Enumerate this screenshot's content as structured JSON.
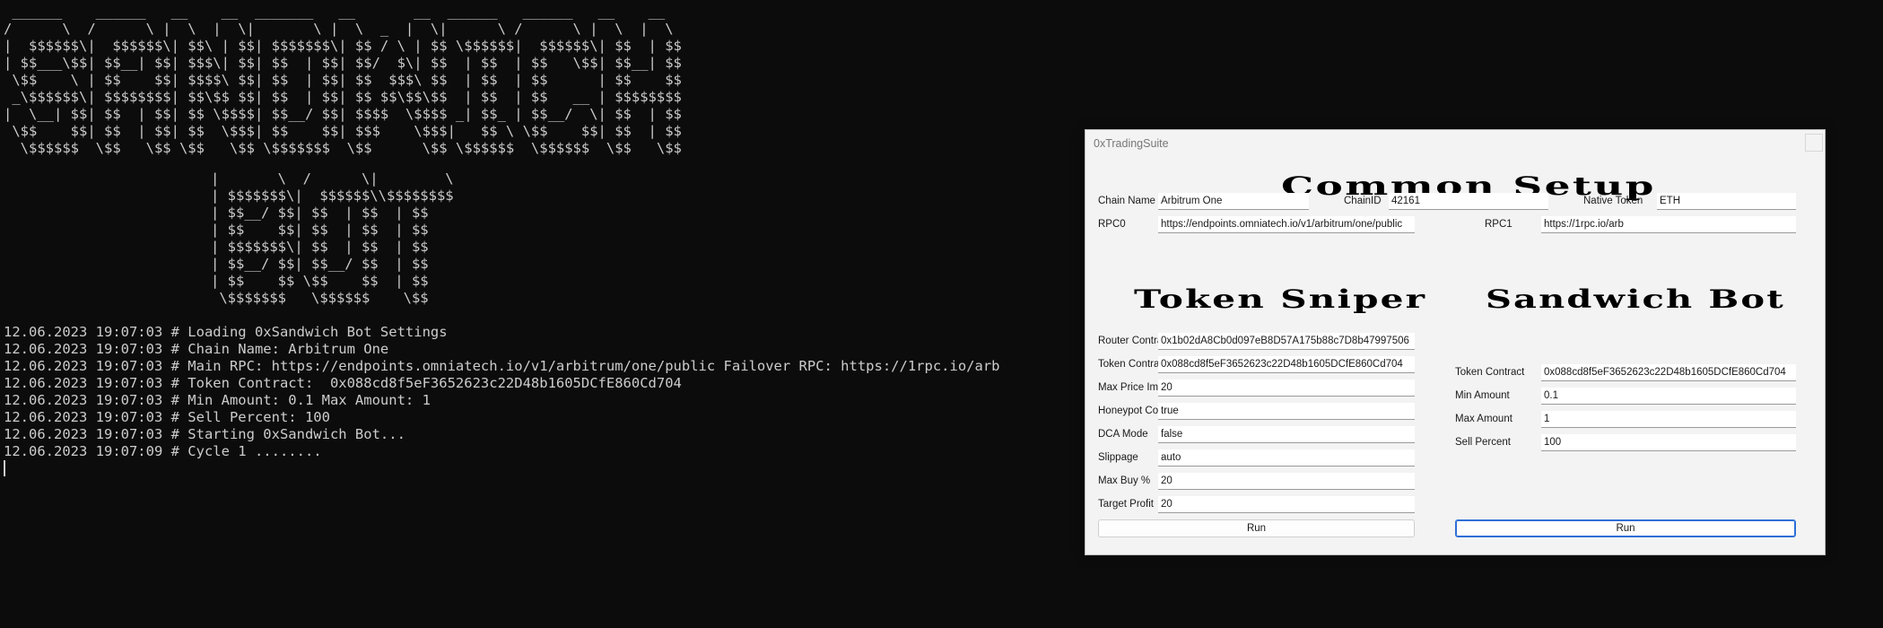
{
  "console": {
    "ascii_top": " ______    ______   __    __  _______   __       __  ______   ______   __    __ \n/      \\  /      \\ |  \\  |  \\|       \\ |  \\  _  |  \\|      \\ /      \\ |  \\  |  \\\n|  $$$$$$\\|  $$$$$$\\| $$\\ | $$| $$$$$$$\\| $$ / \\ | $$ \\$$$$$$|  $$$$$$\\| $$  | $$\n| $$___\\$$| $$__| $$| $$$\\| $$| $$  | $$| $$/  $\\| $$  | $$  | $$   \\$$| $$__| $$\n \\$$    \\ | $$    $$| $$$$\\ $$| $$  | $$| $$  $$$\\ $$  | $$  | $$      | $$    $$\n _\\$$$$$$\\| $$$$$$$$| $$\\$$ $$| $$  | $$| $$ $$\\$$\\$$  | $$  | $$   __ | $$$$$$$$\n|  \\__| $$| $$  | $$| $$ \\$$$$| $$__/ $$| $$$$  \\$$$$ _| $$_ | $$__/  \\| $$  | $$\n \\$$    $$| $$  | $$| $$  \\$$$| $$    $$| $$$    \\$$$|   $$ \\ \\$$    $$| $$  | $$\n  \\$$$$$$  \\$$   \\$$ \\$$   \\$$ \\$$$$$$$  \\$$      \\$$ \\$$$$$$  \\$$$$$$  \\$$   \\$$",
    "ascii_bottom": "|       \\  /      \\|        \\\n| $$$$$$$\\|  $$$$$$\\\\$$$$$$$$\n| $$__/ $$| $$  | $$  | $$\n| $$    $$| $$  | $$  | $$\n| $$$$$$$\\| $$  | $$  | $$\n| $$__/ $$| $$__/ $$  | $$\n| $$    $$ \\$$    $$  | $$\n \\$$$$$$$   \\$$$$$$    \\$$",
    "log_lines": [
      "12.06.2023 19:07:03 # Loading 0xSandwich Bot Settings",
      "12.06.2023 19:07:03 # Chain Name: Arbitrum One",
      "12.06.2023 19:07:03 # Main RPC: https://endpoints.omniatech.io/v1/arbitrum/one/public Failover RPC: https://1rpc.io/arb",
      "12.06.2023 19:07:03 # Token Contract:  0x088cd8f5eF3652623c22D48b1605DCfE860Cd704",
      "12.06.2023 19:07:03 # Min Amount: 0.1 Max Amount: 1",
      "12.06.2023 19:07:03 # Sell Percent: 100",
      "12.06.2023 19:07:03 # Starting 0xSandwich Bot...",
      "12.06.2023 19:07:09 # Cycle 1 ........"
    ]
  },
  "window": {
    "title": "0xTradingSuite",
    "close_glyph": "✕",
    "common_setup": {
      "heading": "Common Setup",
      "chain_name_label": "Chain Name",
      "chain_name_value": "Arbitrum One",
      "chain_id_label": "ChainID",
      "chain_id_value": "42161",
      "native_token_label": "Native Token",
      "native_token_value": "ETH",
      "rpc0_label": "RPC0",
      "rpc0_value": "https://endpoints.omniatech.io/v1/arbitrum/one/public",
      "rpc1_label": "RPC1",
      "rpc1_value": "https://1rpc.io/arb"
    },
    "token_sniper": {
      "heading": "Token Sniper",
      "router_contract_label": "Router Contract",
      "router_contract_value": "0x1b02dA8Cb0d097eB8D57A175b88c7D8b47997506",
      "token_contract_label": "Token Contract",
      "token_contract_value": "0x088cd8f5eF3652623c22D48b1605DCfE860Cd704",
      "max_price_impact_label": "Max Price Impact",
      "max_price_impact_value": "20",
      "honeypot_control_label": "Honeypot Control",
      "honeypot_control_value": "true",
      "dca_mode_label": "DCA Mode",
      "dca_mode_value": "false",
      "slippage_label": "Slippage",
      "slippage_value": "auto",
      "max_buy_label": "Max Buy %",
      "max_buy_value": "20",
      "target_profit_label": "Target Profit",
      "target_profit_value": "20",
      "run_label": "Run"
    },
    "sandwich_bot": {
      "heading": "Sandwich Bot",
      "token_contract_label": "Token Contract",
      "token_contract_value": "0x088cd8f5eF3652623c22D48b1605DCfE860Cd704",
      "min_amount_label": "Min Amount",
      "min_amount_value": "0.1",
      "max_amount_label": "Max Amount",
      "max_amount_value": "1",
      "sell_percent_label": "Sell Percent",
      "sell_percent_value": "100",
      "run_label": "Run"
    }
  }
}
